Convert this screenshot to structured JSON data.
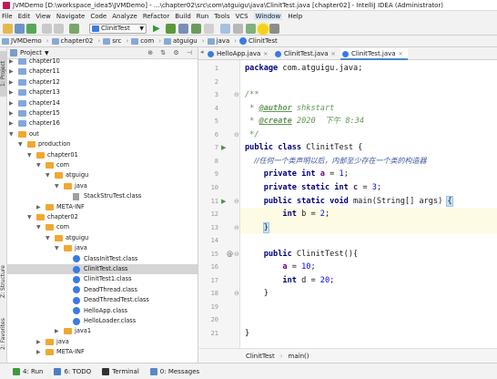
{
  "window": {
    "title": "JVMDemo [D:\\workspace_idea5\\JVMDemo] - ...\\chapter02\\src\\com\\atguigu\\java\\ClinitTest.java [chapter02] - IntelliJ IDEA (Administrator)"
  },
  "menu": [
    "File",
    "Edit",
    "View",
    "Navigate",
    "Code",
    "Analyze",
    "Refactor",
    "Build",
    "Run",
    "Tools",
    "VCS",
    "Window",
    "Help"
  ],
  "toolbar": {
    "run_config": "ClinitTest"
  },
  "breadcrumb": [
    "JVMDemo",
    "chapter02",
    "src",
    "com",
    "atguigu",
    "java",
    "ClinitTest"
  ],
  "project_panel": {
    "title": "Project",
    "tree": [
      {
        "label": "chapter10",
        "depth": 0,
        "kind": "folder",
        "expanded": false
      },
      {
        "label": "chapter11",
        "depth": 0,
        "kind": "folder",
        "expanded": false
      },
      {
        "label": "chapter12",
        "depth": 0,
        "kind": "folder",
        "expanded": false
      },
      {
        "label": "chapter13",
        "depth": 0,
        "kind": "folder",
        "expanded": false
      },
      {
        "label": "chapter14",
        "depth": 0,
        "kind": "folder",
        "expanded": false
      },
      {
        "label": "chapter15",
        "depth": 0,
        "kind": "folder",
        "expanded": false
      },
      {
        "label": "chapter16",
        "depth": 0,
        "kind": "folder",
        "expanded": false
      },
      {
        "label": "out",
        "depth": 0,
        "kind": "folder-orange",
        "expanded": true
      },
      {
        "label": "production",
        "depth": 1,
        "kind": "folder-orange",
        "expanded": true
      },
      {
        "label": "chapter01",
        "depth": 2,
        "kind": "folder-orange",
        "expanded": true
      },
      {
        "label": "com",
        "depth": 3,
        "kind": "folder-orange",
        "expanded": true
      },
      {
        "label": "atguigu",
        "depth": 4,
        "kind": "folder-orange",
        "expanded": true
      },
      {
        "label": "java",
        "depth": 5,
        "kind": "folder-orange",
        "expanded": true
      },
      {
        "label": "StackStruTest.class",
        "depth": 6,
        "kind": "file",
        "expanded": null
      },
      {
        "label": "META-INF",
        "depth": 3,
        "kind": "folder-orange",
        "expanded": false
      },
      {
        "label": "chapter02",
        "depth": 2,
        "kind": "folder-orange",
        "expanded": true
      },
      {
        "label": "com",
        "depth": 3,
        "kind": "folder-orange",
        "expanded": true
      },
      {
        "label": "atguigu",
        "depth": 4,
        "kind": "folder-orange",
        "expanded": true
      },
      {
        "label": "java",
        "depth": 5,
        "kind": "folder-orange",
        "expanded": true
      },
      {
        "label": "ClassInitTest.class",
        "depth": 6,
        "kind": "class",
        "expanded": null
      },
      {
        "label": "ClinitTest.class",
        "depth": 6,
        "kind": "class",
        "expanded": null,
        "selected": true
      },
      {
        "label": "ClinitTest1.class",
        "depth": 6,
        "kind": "class",
        "expanded": null
      },
      {
        "label": "DeadThread.class",
        "depth": 6,
        "kind": "class",
        "expanded": null
      },
      {
        "label": "DeadThreadTest.class",
        "depth": 6,
        "kind": "class",
        "expanded": null
      },
      {
        "label": "HelloApp.class",
        "depth": 6,
        "kind": "class",
        "expanded": null
      },
      {
        "label": "HelloLoader.class",
        "depth": 6,
        "kind": "class",
        "expanded": null
      },
      {
        "label": "java1",
        "depth": 5,
        "kind": "folder-orange",
        "expanded": false
      },
      {
        "label": "java",
        "depth": 3,
        "kind": "folder-orange",
        "expanded": false
      },
      {
        "label": "META-INF",
        "depth": 3,
        "kind": "folder-orange",
        "expanded": false
      }
    ]
  },
  "left_stripe": {
    "project": "1: Project",
    "structure": "Z: Structure",
    "favorites": "2: Favorites"
  },
  "editor": {
    "tabs": [
      {
        "label": "HelloApp.java",
        "active": false
      },
      {
        "label": "ClinitTest.java",
        "active": false
      },
      {
        "label": "ClinitTest.java",
        "active": true
      }
    ],
    "lines": [
      {
        "n": "1",
        "tokens": [
          [
            "kw",
            "package "
          ],
          [
            "",
            "com.atguigu.java;"
          ]
        ]
      },
      {
        "n": "2",
        "tokens": []
      },
      {
        "n": "3",
        "tokens": [
          [
            "doc",
            "/**"
          ]
        ]
      },
      {
        "n": "4",
        "tokens": [
          [
            "doc",
            " * "
          ],
          [
            "tag",
            "@author"
          ],
          [
            "doc",
            " shkstart"
          ]
        ]
      },
      {
        "n": "5",
        "tokens": [
          [
            "doc",
            " * "
          ],
          [
            "tag",
            "@create"
          ],
          [
            "doc",
            " 2020  下午 8:34"
          ]
        ]
      },
      {
        "n": "6",
        "tokens": [
          [
            "doc",
            " */"
          ]
        ]
      },
      {
        "n": "7",
        "tokens": [
          [
            "kw",
            "public class "
          ],
          [
            "",
            "ClinitTest {"
          ]
        ]
      },
      {
        "n": "8",
        "tokens": [
          [
            "zh",
            "    //任何一个类声明以后，内部至少存在一个类的构造器"
          ]
        ]
      },
      {
        "n": "9",
        "tokens": [
          [
            "kw",
            "    private int "
          ],
          [
            "fld",
            "a"
          ],
          [
            "",
            " = "
          ],
          [
            "num",
            "1"
          ],
          [
            "",
            ";"
          ]
        ]
      },
      {
        "n": "10",
        "tokens": [
          [
            "kw",
            "    private static int "
          ],
          [
            "fld",
            "c"
          ],
          [
            "",
            " = "
          ],
          [
            "num",
            "3"
          ],
          [
            "",
            ";"
          ]
        ]
      },
      {
        "n": "11",
        "tokens": [
          [
            "kw",
            "    public static void "
          ],
          [
            "",
            "main(String[] args) "
          ],
          [
            "brk",
            "{"
          ]
        ]
      },
      {
        "n": "12",
        "tokens": [
          [
            "kw",
            "        int "
          ],
          [
            "",
            "b = "
          ],
          [
            "num",
            "2"
          ],
          [
            "",
            ";"
          ]
        ],
        "highlight": true
      },
      {
        "n": "13",
        "tokens": [
          [
            "",
            "    "
          ],
          [
            "brk",
            "}"
          ]
        ],
        "highlight": true
      },
      {
        "n": "14",
        "tokens": []
      },
      {
        "n": "15",
        "tokens": [
          [
            "kw",
            "    public "
          ],
          [
            "",
            "ClinitTest(){"
          ]
        ]
      },
      {
        "n": "16",
        "tokens": [
          [
            "fld",
            "        a"
          ],
          [
            "",
            " = "
          ],
          [
            "num",
            "10"
          ],
          [
            "",
            ";"
          ]
        ]
      },
      {
        "n": "17",
        "tokens": [
          [
            "kw",
            "        int "
          ],
          [
            "",
            "d = "
          ],
          [
            "num",
            "20"
          ],
          [
            "",
            ";"
          ]
        ]
      },
      {
        "n": "18",
        "tokens": [
          [
            "",
            "    }"
          ]
        ]
      },
      {
        "n": "19",
        "tokens": []
      },
      {
        "n": "20",
        "tokens": []
      },
      {
        "n": "21",
        "tokens": [
          [
            "",
            "}"
          ]
        ]
      }
    ],
    "breadcrumb": [
      "ClinitTest",
      "main()"
    ]
  },
  "bottom_tabs": [
    "4: Run",
    "6: TODO",
    "Terminal",
    "0: Messages"
  ],
  "colors": {
    "keyword": "#000080",
    "field": "#660e7a",
    "number": "#0000ff",
    "doc": "#629755",
    "selection": "#d5d5d5",
    "accent": "#3b7be0"
  }
}
